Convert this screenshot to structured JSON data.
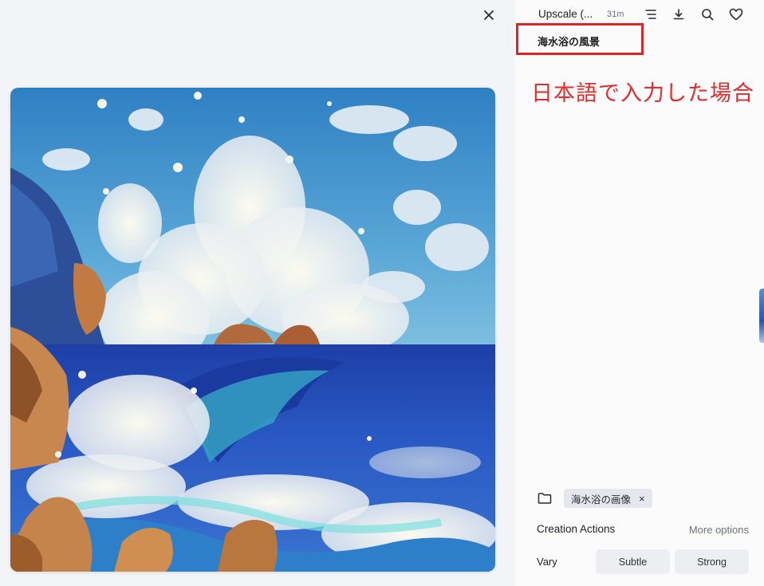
{
  "viewer": {
    "close_icon": "close-icon"
  },
  "header": {
    "title": "Upscale (...",
    "time": "31m",
    "icons": [
      "menu-icon",
      "download-icon",
      "search-icon",
      "heart-icon"
    ]
  },
  "prompt": {
    "text": "海水浴の風景"
  },
  "annotation": {
    "text": "日本語で入力した場合"
  },
  "folder": {
    "icon": "folder-icon",
    "tag_label": "海水浴の画像",
    "tag_remove": "×"
  },
  "creation_actions": {
    "title": "Creation Actions",
    "more_options": "More options",
    "vary_label": "Vary",
    "vary_subtle": "Subtle",
    "vary_strong": "Strong"
  },
  "colors": {
    "annotation_red": "#e32b2b",
    "prompt_border": "#e02424"
  }
}
